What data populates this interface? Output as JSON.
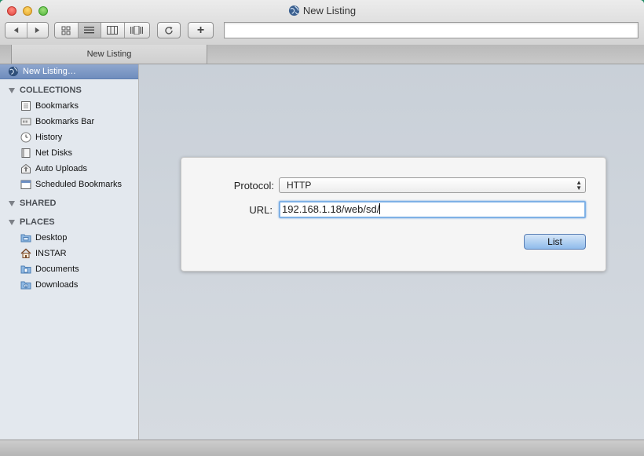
{
  "window": {
    "title": "New Listing"
  },
  "toolbar": {
    "back_icon": "back-arrow-icon",
    "forward_icon": "forward-arrow-icon",
    "view_icons": [
      "icon-view-icon",
      "list-view-icon",
      "column-view-icon",
      "coverflow-view-icon"
    ],
    "selected_view": "list-view-icon",
    "reload_icon": "reload-icon",
    "add_label": "+",
    "address_value": ""
  },
  "tab": {
    "label": "New Listing"
  },
  "sidebar": {
    "selected_item": "New Listing…",
    "sections": [
      {
        "title": "COLLECTIONS",
        "items": [
          {
            "label": "Bookmarks",
            "icon": "bookmarks-icon"
          },
          {
            "label": "Bookmarks Bar",
            "icon": "bookmarks-bar-icon"
          },
          {
            "label": "History",
            "icon": "history-clock-icon"
          },
          {
            "label": "Net Disks",
            "icon": "net-disks-icon"
          },
          {
            "label": "Auto Uploads",
            "icon": "auto-uploads-icon"
          },
          {
            "label": "Scheduled Bookmarks",
            "icon": "calendar-icon"
          }
        ]
      },
      {
        "title": "SHARED",
        "items": []
      },
      {
        "title": "PLACES",
        "items": [
          {
            "label": "Desktop",
            "icon": "desktop-folder-icon"
          },
          {
            "label": "INSTAR",
            "icon": "home-icon"
          },
          {
            "label": "Documents",
            "icon": "documents-folder-icon"
          },
          {
            "label": "Downloads",
            "icon": "downloads-folder-icon"
          }
        ]
      }
    ]
  },
  "form": {
    "protocol_label": "Protocol:",
    "protocol_value": "HTTP",
    "url_label": "URL:",
    "url_value": "192.168.1.18/web/sd/",
    "list_button": "List"
  },
  "colors": {
    "selection": "#7d98c6",
    "sidebar_bg": "#e3e8ee",
    "content_bg": "#cfd5dc",
    "focus_ring": "#7fb1e6",
    "default_button": "#9cc3ee"
  }
}
